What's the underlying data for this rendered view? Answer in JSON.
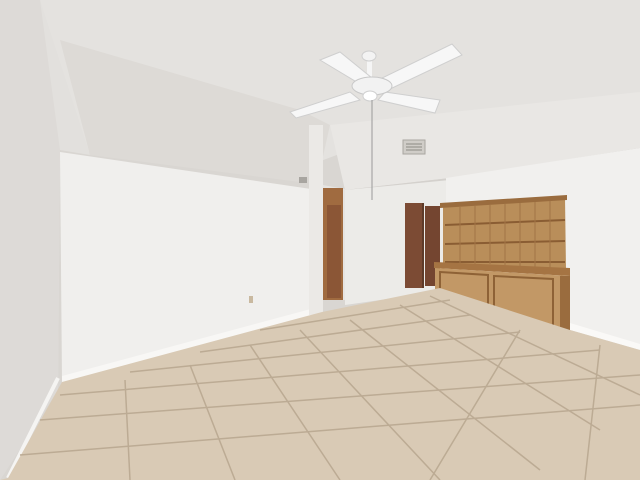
{
  "scene": {
    "description_tags": [
      "ceiling-fan",
      "tile-floor",
      "wooden-hutch",
      "wooden-doors",
      "half-wall"
    ],
    "colors": {
      "ceiling": "#e6e4e1",
      "ceiling_shadow": "#cfccc8",
      "wall_light": "#f2f1ef",
      "wall_shadow": "#dcdad7",
      "left_wall": "#e1dfdc",
      "floor": "#d8c9b4",
      "floor_grout": "#bfae97",
      "wood": "#b68a56",
      "wood_dark": "#7a4a2c",
      "door": "#7c4b34"
    }
  }
}
